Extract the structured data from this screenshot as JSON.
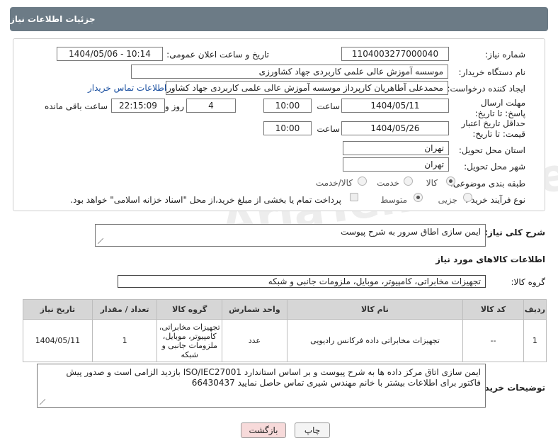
{
  "header": {
    "title": "جزئیات اطلاعات نیاز"
  },
  "form": {
    "need_number": {
      "label": "شماره نیاز:",
      "value": "1104003277000040"
    },
    "announce_datetime": {
      "label": "تاریخ و ساعت اعلان عمومی:",
      "value": "1404/05/06 - 10:14"
    },
    "buyer_org": {
      "label": "نام دستگاه خریدار:",
      "value": "موسسه آموزش عالی علمی کاربردی جهاد کشاورزی"
    },
    "creator": {
      "label": "ایجاد کننده درخواست:",
      "value": "محمدعلی آطاهریان کارپرداز موسسه آموزش عالی علمی کاربردی جهاد کشاورزی",
      "contact_link": "اطلاعات تماس خریدار"
    },
    "reply_deadline": {
      "label": "مهلت ارسال پاسخ: تا تاریخ:",
      "date": "1404/05/11",
      "time_label": "ساعت",
      "time": "10:00",
      "days": "4",
      "days_label": "روز و",
      "remaining": "22:15:09",
      "remaining_label": "ساعت باقی مانده"
    },
    "price_validity": {
      "label": "حداقل تاریخ اعتبار قیمت: تا تاریخ:",
      "date": "1404/05/26",
      "time_label": "ساعت",
      "time": "10:00"
    },
    "delivery_province": {
      "label": "استان محل تحویل:",
      "value": "تهران"
    },
    "delivery_city": {
      "label": "شهر محل تحویل:",
      "value": "تهران"
    },
    "category": {
      "label": "طبقه بندی موضوعی:",
      "options": [
        "کالا",
        "خدمت",
        "کالا/خدمت"
      ],
      "selected": "کالا"
    },
    "purchase_process": {
      "label": "نوع فرآیند خرید :",
      "options": [
        "جزیی",
        "متوسط"
      ],
      "selected": "متوسط",
      "note": "پرداخت تمام یا بخشی از مبلغ خرید،از محل \"اسناد خزانه اسلامی\" خواهد بود."
    }
  },
  "summary": {
    "label": "شرح کلی نیاز:",
    "value": "ایمن سازی اطاق سرور به شرح پیوست"
  },
  "goods": {
    "section_title": "اطلاعات کالاهای مورد نیاز",
    "group_label": "گروه کالا:",
    "group_value": "تجهیزات مخابراتی، کامپیوتر، موبایل، ملزومات جانبی و شبکه",
    "columns": [
      "ردیف",
      "کد کالا",
      "نام کالا",
      "واحد شمارش",
      "گروه کالا",
      "تعداد / مقدار",
      "تاریخ نیاز"
    ],
    "rows": [
      [
        "1",
        "--",
        "تجهیزات مخابراتی داده فرکانس رادیویی",
        "عدد",
        "تجهیزات مخابراتی، کامپیوتر، موبایل، ملزومات جانبی و شبکه",
        "1",
        "1404/05/11"
      ]
    ]
  },
  "buyer_notes": {
    "label": "توضیحات خریدار:",
    "value": "ایمن سازی اتاق مرکز داده ها به شرح پیوست و بر اساس استاندارد ISO/IEC27001  بازدید الزامی است و صدور پیش فاکتور برای اطلاعات بیشتر با خانم مهندس شیری تماس حاصل نمایید 66430437"
  },
  "buttons": {
    "print": "چاپ",
    "back": "بازگشت"
  },
  "watermark": "AriaTender.neT",
  "colors": {
    "header_bg": "#6c7b86",
    "link": "#1a4fa0",
    "back_button": "#f7dada",
    "table_header": "#d6d6d6"
  }
}
